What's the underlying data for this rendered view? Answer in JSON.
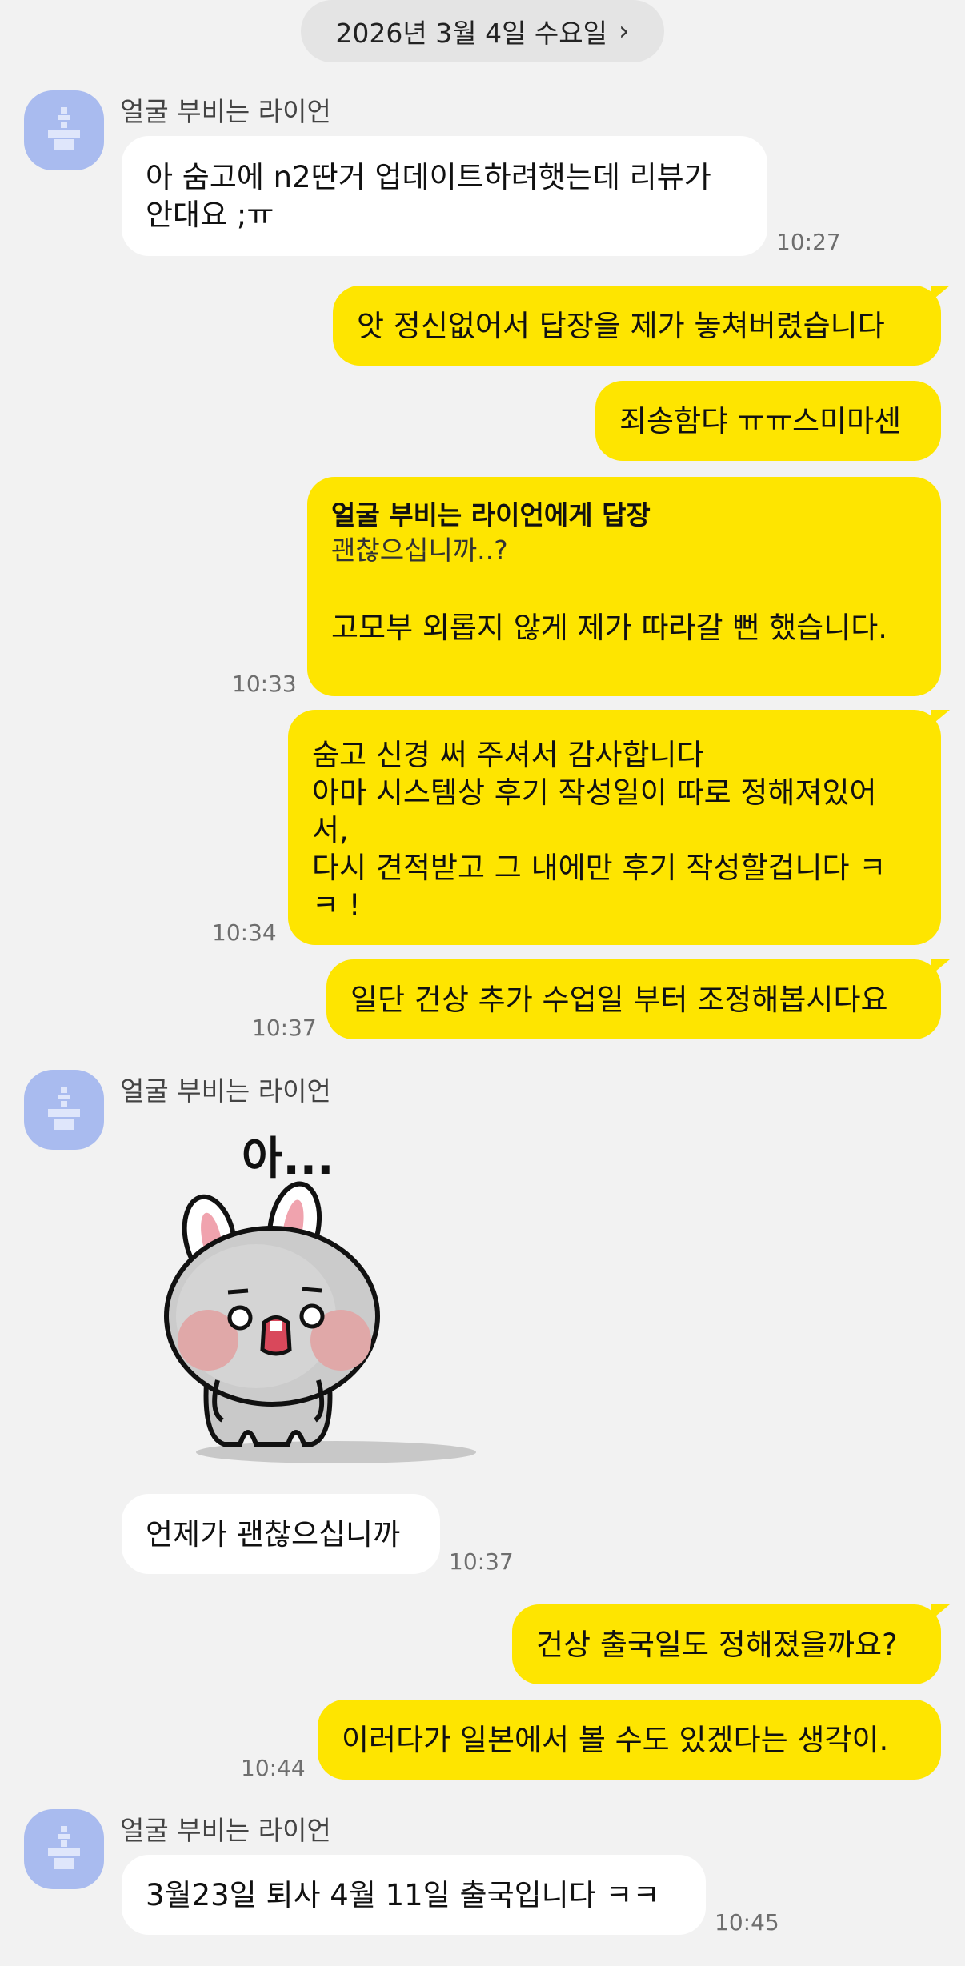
{
  "date_header": {
    "label": "2026년 3월 4일 수요일",
    "chevron": "chevron-right-icon"
  },
  "colors": {
    "background": "#f2f2f2",
    "incoming_bubble": "#ffffff",
    "outgoing_bubble": "#fee500",
    "avatar": "#a9bbef"
  },
  "contact": {
    "name": "얼굴 부비는 라이언",
    "avatar_icon": "default-profile-icon"
  },
  "messages": [
    {
      "dir": "in",
      "text": "아 숨고에 n2딴거 업데이트하려햇는데 리뷰가\n안대요 ;ㅠ",
      "time": "10:27"
    },
    {
      "dir": "out",
      "text": "앗 정신없어서 답장을 제가 놓쳐버렸습니다"
    },
    {
      "dir": "out",
      "text": "죄송함댜 ㅠㅠ스미마센"
    },
    {
      "dir": "out",
      "reply_to": "얼굴 부비는 라이언에게 답장",
      "quote": "괜찮으십니까..?",
      "text": "고모부 외롭지 않게 제가 따라갈 뻔 했습니다.",
      "time": "10:33"
    },
    {
      "dir": "out",
      "text": "숨고 신경 써 주셔서 감사합니다\n아마 시스템상 후기 작성일이 따로 정해져있어\n서,\n다시 견적받고 그 내에만 후기 작성할겁니다 ㅋ\nㅋ !",
      "time": "10:34"
    },
    {
      "dir": "out",
      "text": "일단 건상 추가 수업일 부터 조정해봅시다요",
      "time": "10:37"
    },
    {
      "dir": "in",
      "sticker": "rabbit-sticker",
      "sticker_text": "아..."
    },
    {
      "dir": "in",
      "text": "언제가 괜찮으십니까",
      "time": "10:37"
    },
    {
      "dir": "out",
      "text": "건상 출국일도 정해졌을까요?"
    },
    {
      "dir": "out",
      "text": "이러다가 일본에서 볼 수도 있겠다는 생각이.",
      "time": "10:44"
    },
    {
      "dir": "in",
      "text": "3월23일 퇴사 4월 11일 출국입니다 ㅋㅋ",
      "time": "10:45"
    }
  ]
}
